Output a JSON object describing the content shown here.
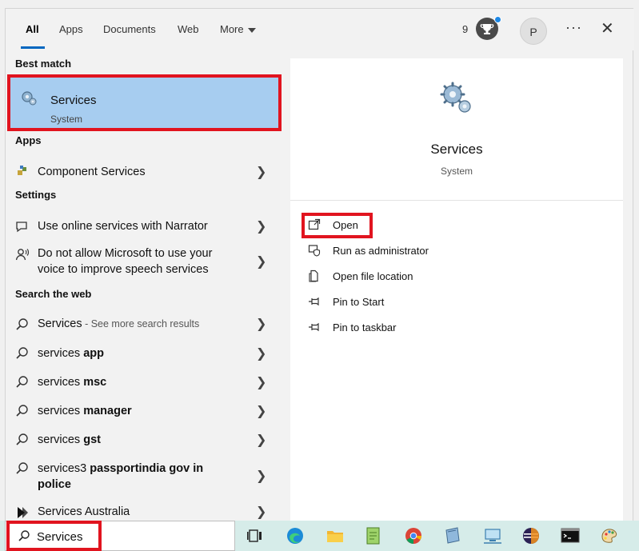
{
  "tabs": [
    "All",
    "Apps",
    "Documents",
    "Web",
    "More"
  ],
  "header": {
    "points": "9",
    "avatar_initial": "P",
    "more_dots": "···",
    "close": "✕"
  },
  "sections": {
    "best_match": "Best match",
    "apps": "Apps",
    "settings": "Settings",
    "search_web": "Search the web"
  },
  "best_match": {
    "title": "Services",
    "subtitle": "System",
    "icon": "services-gear-icon"
  },
  "apps": [
    {
      "label": "Component Services",
      "icon": "component-services-icon"
    }
  ],
  "settings": [
    {
      "label": "Use online services with Narrator",
      "icon": "narrator-icon"
    },
    {
      "label_line1": "Do not allow Microsoft to use your",
      "label_line2": "voice to improve speech services",
      "icon": "speech-icon"
    }
  ],
  "web": [
    {
      "prefix": "Services",
      "suffix": " - See more search results"
    },
    {
      "prefix": "services ",
      "bold": "app"
    },
    {
      "prefix": "services ",
      "bold": "msc"
    },
    {
      "prefix": "services ",
      "bold": "manager"
    },
    {
      "prefix": "services ",
      "bold": "gst"
    },
    {
      "prefix": "services3 ",
      "bold": "passportindia gov in",
      "bold2": "police"
    },
    {
      "prefix": "Services Australia"
    }
  ],
  "preview": {
    "title": "Services",
    "subtitle": "System",
    "actions": [
      "Open",
      "Run as administrator",
      "Open file location",
      "Pin to Start",
      "Pin to taskbar"
    ]
  },
  "search": {
    "value": "Services",
    "placeholder": ""
  },
  "colors": {
    "accent": "#0067c0",
    "highlight": "#a7cdf0",
    "annotation": "#e1141f",
    "taskbar": "#d6ece9"
  }
}
